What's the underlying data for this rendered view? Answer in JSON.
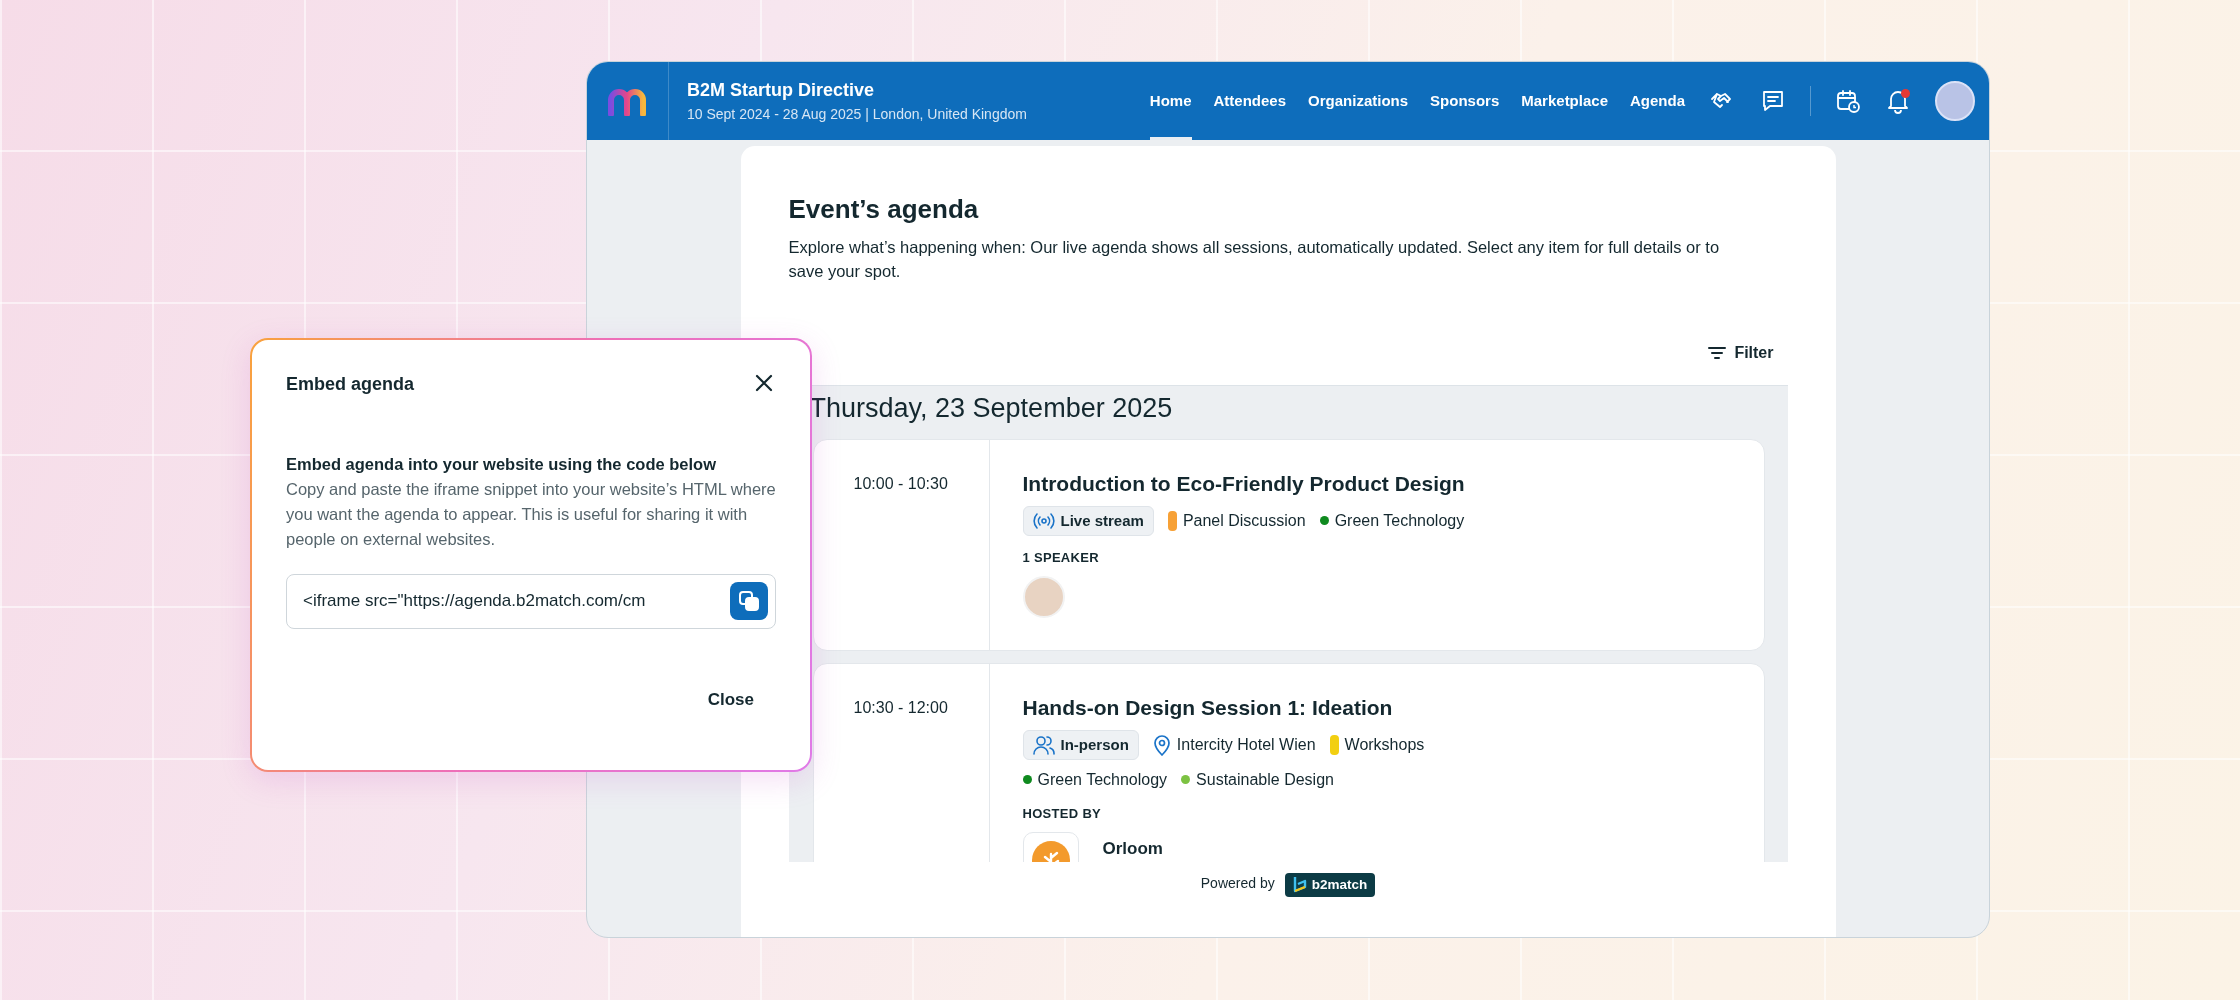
{
  "navbar": {
    "event_title": "B2M Startup Directive",
    "event_subtitle": "10 Sept 2024 - 28 Aug 2025 | London, United Kingdom",
    "nav_items": [
      {
        "label": "Home",
        "selected": true
      },
      {
        "label": "Attendees",
        "selected": false
      },
      {
        "label": "Organizations",
        "selected": false
      },
      {
        "label": "Sponsors",
        "selected": false
      },
      {
        "label": "Marketplace",
        "selected": false
      },
      {
        "label": "Agenda",
        "selected": false
      }
    ],
    "icons": [
      {
        "kind": "handshake"
      },
      {
        "kind": "chat"
      },
      {
        "kind": "divider"
      },
      {
        "kind": "calendar"
      },
      {
        "kind": "bell",
        "unread": true
      },
      {
        "kind": "avatar"
      }
    ]
  },
  "page": {
    "title": "Event’s agenda",
    "description": "Explore what’s happening when: Our live agenda shows all sessions, automatically updated. Select any item for full details or to save your spot.",
    "filter_label": "Filter"
  },
  "day": {
    "heading": "Thursday, 23 September 2025",
    "sessions": [
      {
        "time": "10:00 - 10:30",
        "title": "Introduction to Eco-Friendly Product Design",
        "tags": [
          {
            "kind": "livestream",
            "label": "Live stream"
          },
          {
            "kind": "category",
            "label": "Panel Discussion",
            "color": "#f7a136"
          },
          {
            "kind": "topic",
            "label": "Green Technology",
            "color": "#0f8a1f"
          }
        ],
        "section": {
          "kind": "speakers",
          "label": "1 SPEAKER"
        }
      },
      {
        "time": "10:30 - 12:00",
        "title": "Hands-on Design Session 1: Ideation",
        "tags": [
          {
            "kind": "in-person",
            "label": "In-person"
          },
          {
            "kind": "location",
            "label": "Intercity Hotel Wien"
          },
          {
            "kind": "category",
            "label": "Workshops",
            "color": "#f2cf11"
          },
          {
            "kind": "break"
          },
          {
            "kind": "topic",
            "label": "Green Technology",
            "color": "#0f8a1f"
          },
          {
            "kind": "topic",
            "label": "Sustainable Design",
            "color": "#7cc242"
          }
        ],
        "section": {
          "kind": "host",
          "label": "HOSTED BY",
          "name": "Orloom"
        }
      }
    ]
  },
  "footer": {
    "powered_by": "Powered by",
    "brand": "b2match"
  },
  "modal": {
    "title": "Embed agenda",
    "heading": "Embed agenda into your website using the code below",
    "body": "Copy and paste the iframe snippet into your website’s HTML where you want the agenda to appear. This is useful for sharing it with people on external websites.",
    "code_value": "<iframe src=\"https://agenda.b2match.com/cm",
    "close_label": "Close"
  }
}
